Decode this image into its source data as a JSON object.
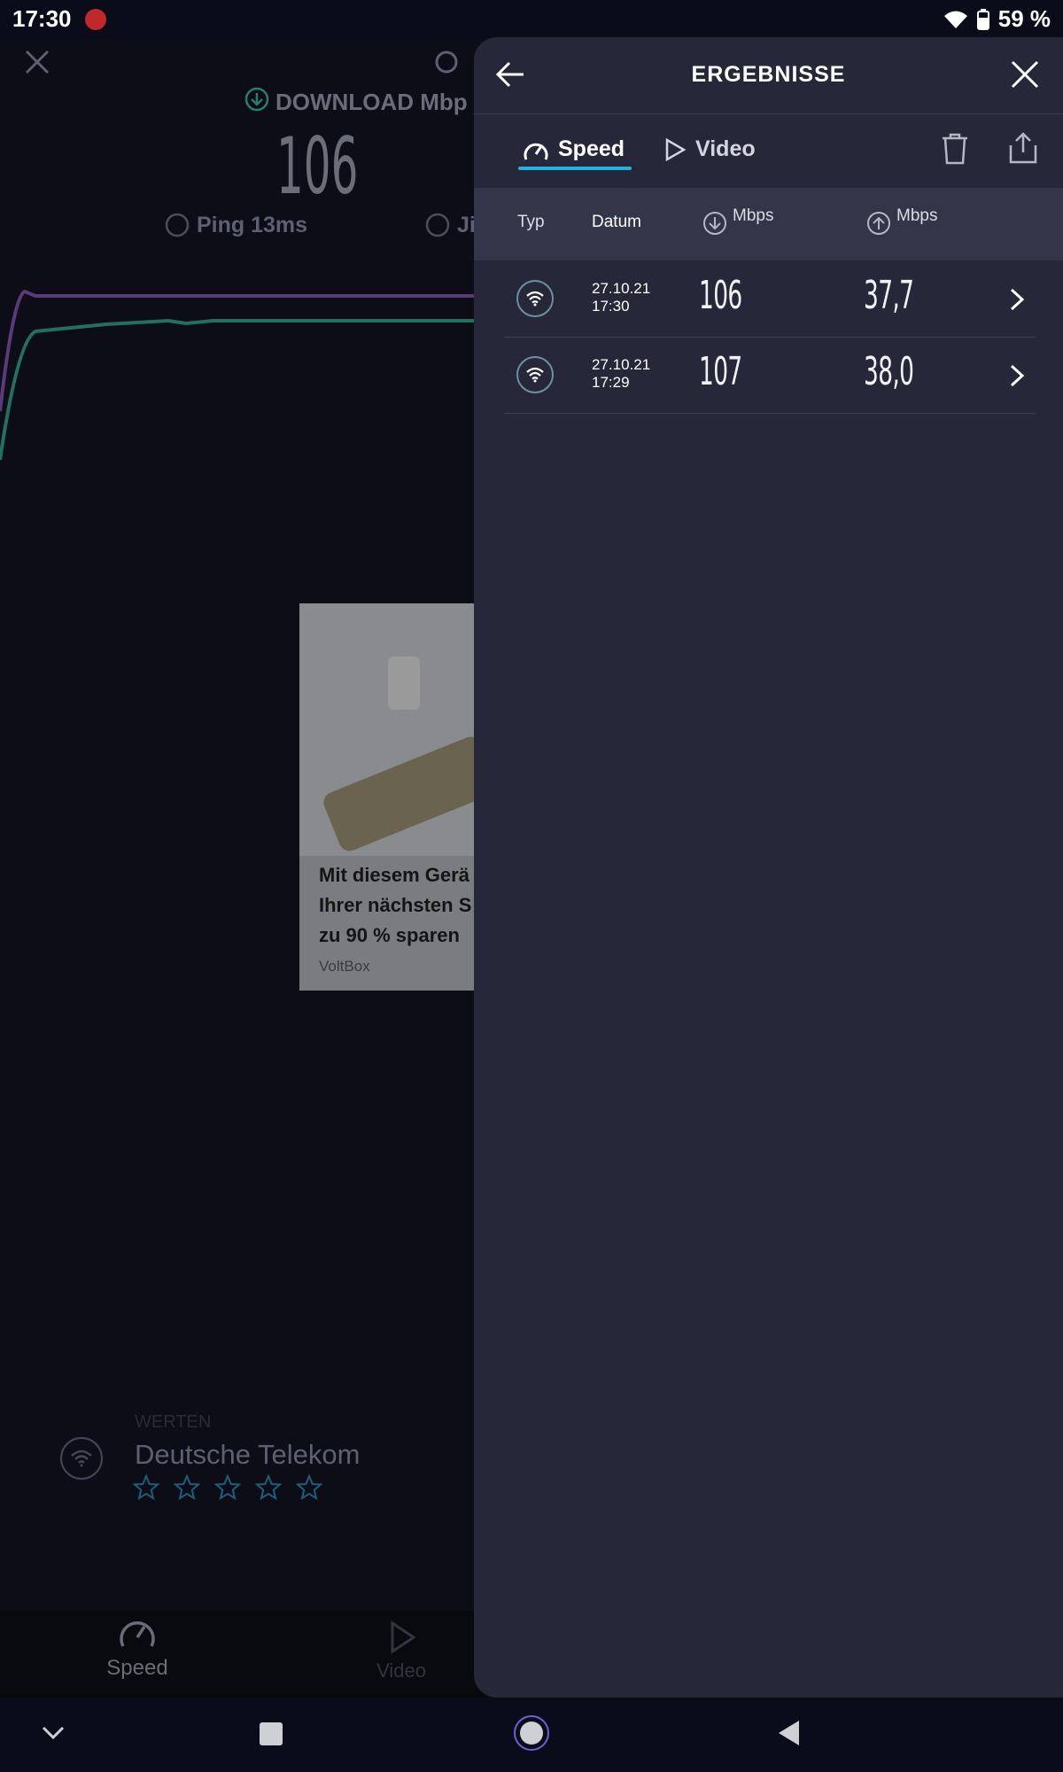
{
  "status_bar": {
    "time": "17:30",
    "battery": "59 %"
  },
  "background": {
    "download_label": "DOWNLOAD Mbp",
    "download_value": "106",
    "ping_label": "Ping 13ms",
    "jitter_label": "Ji",
    "ad_title": "Mit diesem Gerä\nIhrer nächsten S\nzu 90 % sparen",
    "ad_source": "VoltBox",
    "rating_hint": "WERTEN",
    "provider": "Deutsche Telekom",
    "bottom_tabs": [
      {
        "label": "Speed"
      },
      {
        "label": "Video"
      }
    ]
  },
  "panel": {
    "title": "ERGEBNISSE",
    "tabs": [
      {
        "label": "Speed",
        "active": true
      },
      {
        "label": "Video",
        "active": false
      }
    ],
    "columns": {
      "type": "Typ",
      "date": "Datum",
      "download": "Mbps",
      "upload": "Mbps"
    },
    "results": [
      {
        "date": "27.10.21",
        "time": "17:30",
        "download": "106",
        "upload": "37,7"
      },
      {
        "date": "27.10.21",
        "time": "17:29",
        "download": "107",
        "upload": "38,0"
      }
    ]
  },
  "colors": {
    "accent": "#1fb4e5",
    "panel_bg": "#262839",
    "download": "#3cb89a",
    "upload": "#9b59d0"
  }
}
